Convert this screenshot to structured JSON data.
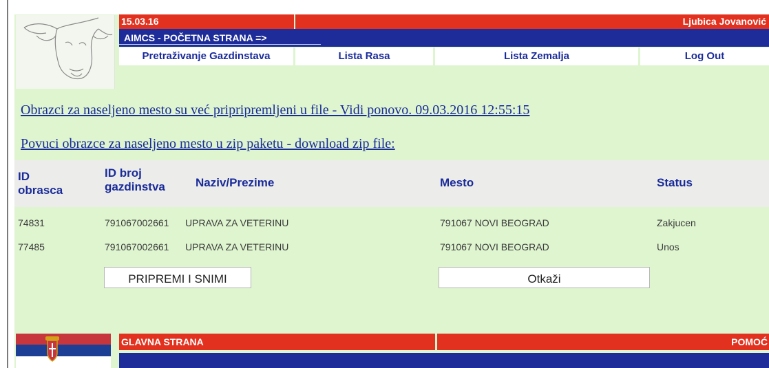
{
  "header": {
    "date": "15.03.16",
    "user_name": "Ljubica Jovanović",
    "title": "AIMCS - POČETNA STRANA =>"
  },
  "nav": {
    "items": [
      "Pretraživanje Gazdinstava",
      "Lista Rasa",
      "Lista Zemalja",
      "Log Out"
    ]
  },
  "links": {
    "prepared_forms": "Obrazci za naseljeno mesto su već pripripremljeni u file - Vidi ponovo. 09.03.2016 12:55:15",
    "download_zip": "Povuci obrazce za naseljeno mesto u zip paketu - download zip file:"
  },
  "table": {
    "columns": [
      "ID\nobrasca",
      "ID broj\ngazdinstva",
      "Naziv/Prezime",
      "Mesto",
      "Status"
    ],
    "rows": [
      [
        "74831",
        "791067002661",
        "UPRAVA ZA VETERINU",
        "791067 NOVI BEOGRAD",
        "Zakjucen"
      ],
      [
        "77485",
        "791067002661",
        "UPRAVA ZA VETERINU",
        "791067 NOVI BEOGRAD",
        "Unos"
      ]
    ]
  },
  "buttons": {
    "prepare_save": "PRIPREMI I SNIMI",
    "cancel": "Otkaži"
  },
  "footer": {
    "home": "GLAVNA STRANA",
    "help": "POMOĆ"
  },
  "colors": {
    "red": "#e2321f",
    "blue": "#1d2c99",
    "panel_bg": "#def5cf",
    "link": "#1a2b9a"
  },
  "icons": {
    "logo": "cow-head-sketch-icon",
    "flag": "serbian-flag-icon"
  }
}
